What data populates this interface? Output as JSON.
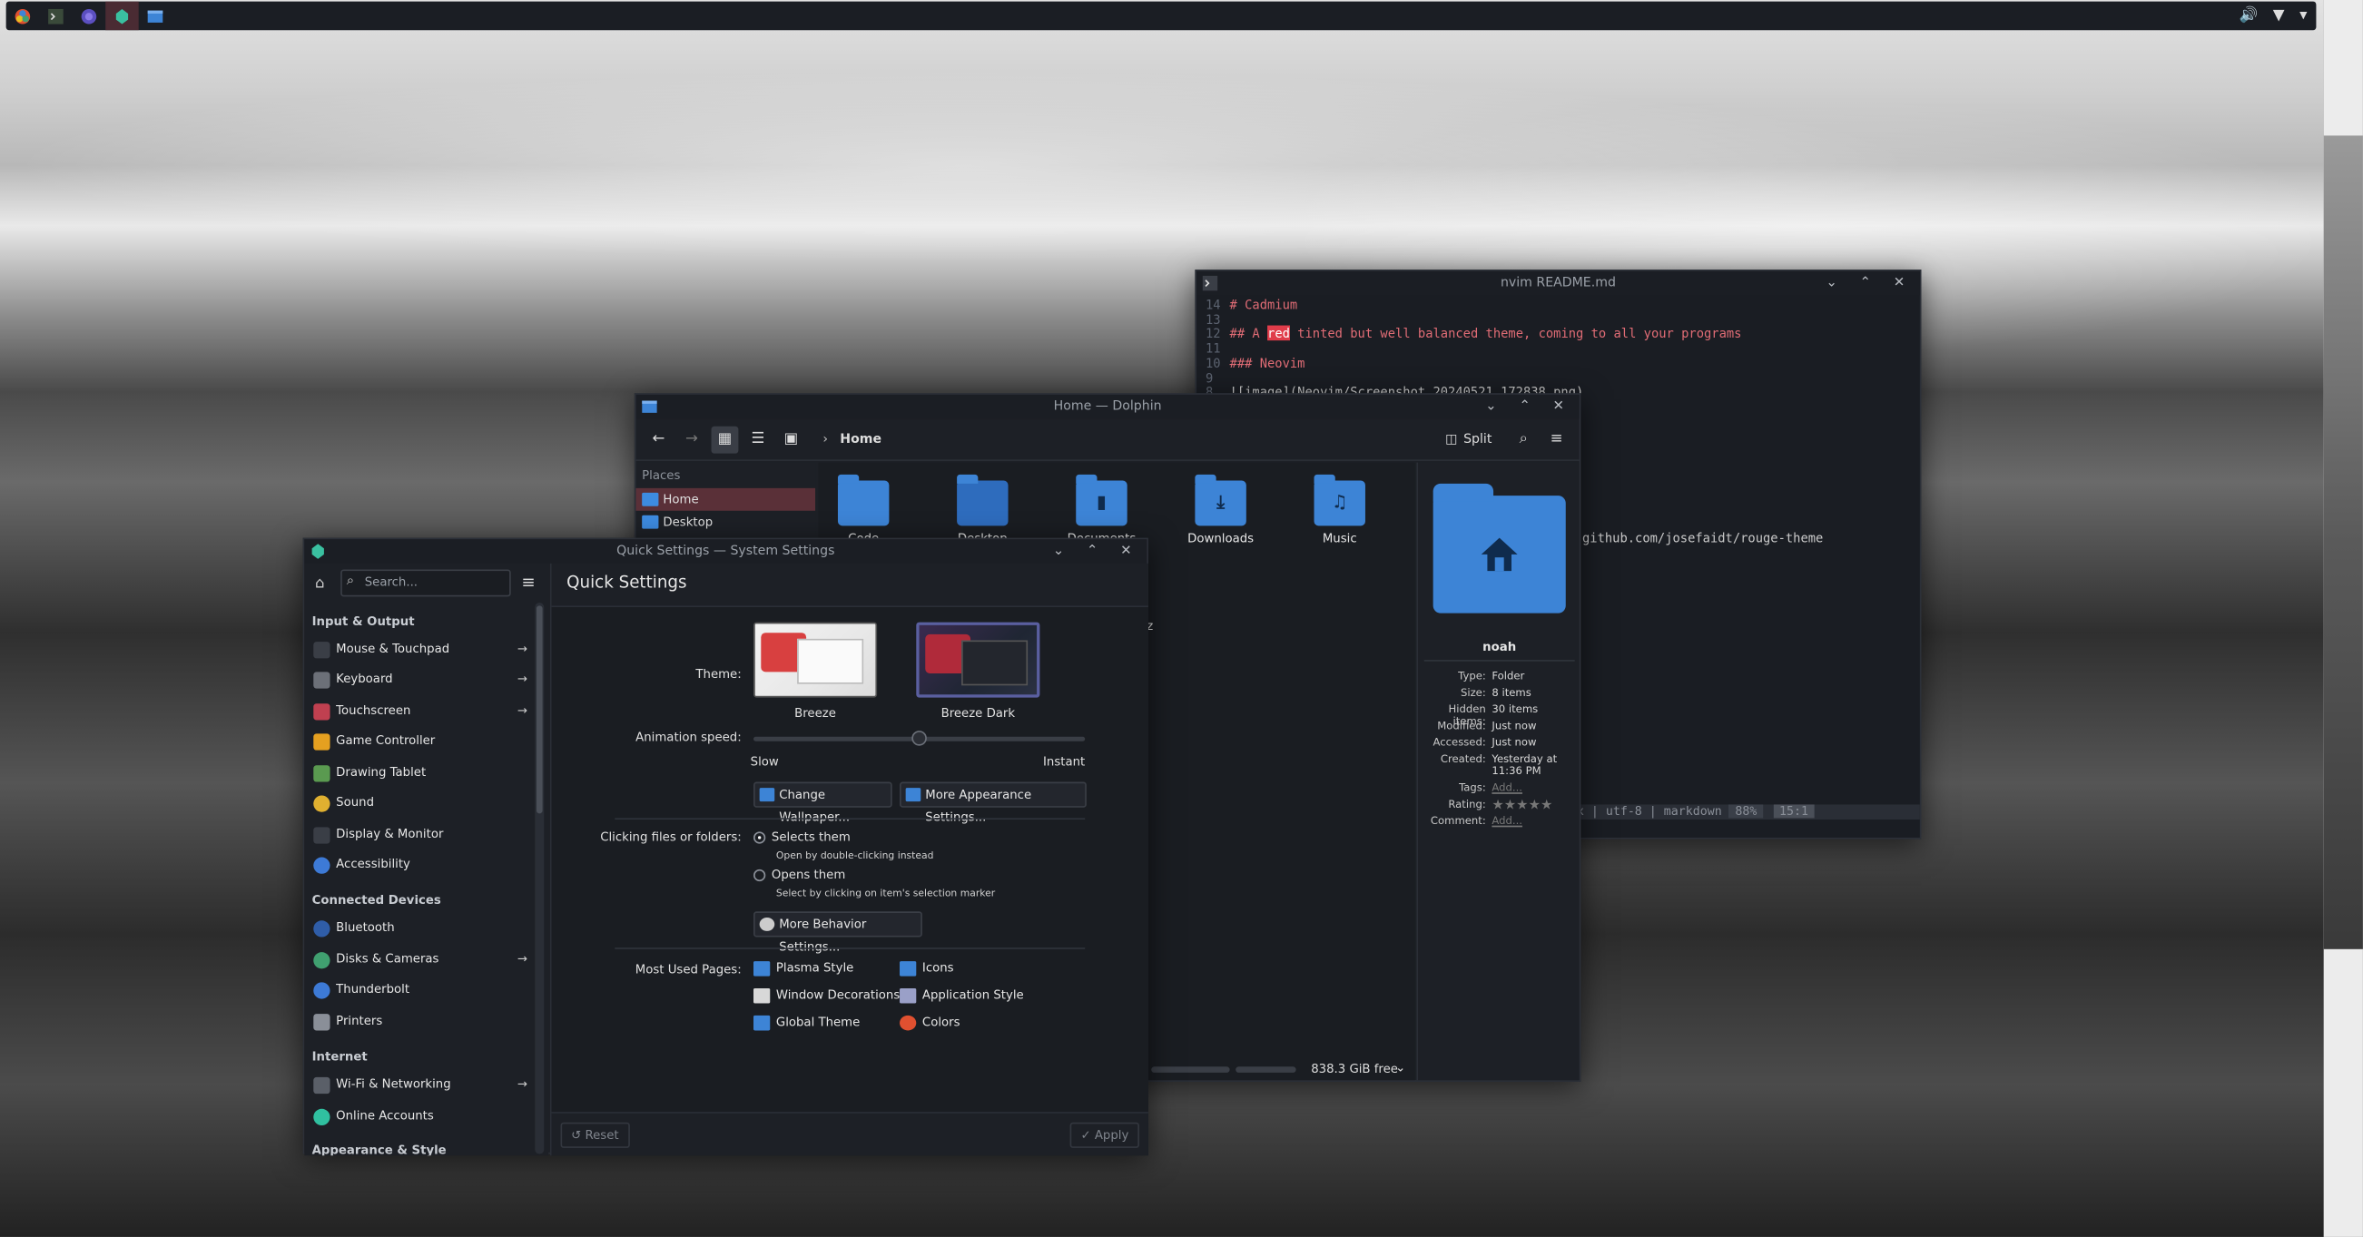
{
  "taskbar": {
    "tray_volume": "🔊",
    "tray_network": "▼",
    "tray_menu": "▾"
  },
  "nvim": {
    "title": "nvim README.md",
    "lines": [
      {
        "n": "14",
        "t": "# Cadmium"
      },
      {
        "n": "13",
        "t": ""
      },
      {
        "n": "12",
        "t_pre": "## A ",
        "t_hl": "red",
        "t_post": " tinted but well balanced theme, coming to all your programs"
      },
      {
        "n": "11",
        "t": ""
      },
      {
        "n": "10",
        "t": "### Neovim"
      },
      {
        "n": "9",
        "t": ""
      },
      {
        "n": "8",
        "t": "![image](Neovim/Screenshot_20240521_172838.png)"
      }
    ],
    "url_fragment": "github.com/josefaidt/rouge-theme",
    "status": "unix | utf-8 | markdown",
    "status_pct": "88%",
    "status_pos": "15:1"
  },
  "dolphin": {
    "title": "Home — Dolphin",
    "breadcrumb": "Home",
    "split_label": "Split",
    "places_header": "Places",
    "places": [
      {
        "label": "Home"
      },
      {
        "label": "Desktop"
      }
    ],
    "files": [
      {
        "label": "Code",
        "glyph": ""
      },
      {
        "label": "Desktop",
        "glyph": ""
      },
      {
        "label": "Documents",
        "glyph": "▮"
      },
      {
        "label": "Downloads",
        "glyph": "⤓"
      },
      {
        "label": "Music",
        "glyph": "♫"
      }
    ],
    "partial_z": "z",
    "info": {
      "name": "noah",
      "rows": [
        {
          "k": "Type:",
          "v": "Folder"
        },
        {
          "k": "Size:",
          "v": "8 items"
        },
        {
          "k": "Hidden items:",
          "v": "30 items"
        },
        {
          "k": "Modified:",
          "v": "Just now"
        },
        {
          "k": "Accessed:",
          "v": "Just now"
        },
        {
          "k": "Created:",
          "v": "Yesterday at 11:36 PM"
        },
        {
          "k": "Tags:",
          "v": "Add..."
        },
        {
          "k": "Rating:",
          "v": "★★★★★"
        },
        {
          "k": "Comment:",
          "v": "Add..."
        }
      ]
    },
    "free_space": "838.3 GiB free"
  },
  "settings": {
    "title": "Quick Settings — System Settings",
    "search_placeholder": "Search...",
    "page_title": "Quick Settings",
    "sidebar": {
      "sections": [
        {
          "label": "Input & Output",
          "items": [
            {
              "label": "Mouse & Touchpad",
              "arrow": "→",
              "color": "#3a3e46"
            },
            {
              "label": "Keyboard",
              "arrow": "→",
              "color": "#6c7078"
            },
            {
              "label": "Touchscreen",
              "arrow": "→",
              "color": "#c04050"
            },
            {
              "label": "Game Controller",
              "arrow": "",
              "color": "#e5a020"
            },
            {
              "label": "Drawing Tablet",
              "arrow": "",
              "color": "#5a9a50"
            },
            {
              "label": "Sound",
              "arrow": "",
              "color": "#e0b030"
            },
            {
              "label": "Display & Monitor",
              "arrow": "",
              "color": "#3a3e46"
            },
            {
              "label": "Accessibility",
              "arrow": "",
              "color": "#3d7ad6"
            }
          ]
        },
        {
          "label": "Connected Devices",
          "items": [
            {
              "label": "Bluetooth",
              "arrow": "",
              "color": "#2f5da8"
            },
            {
              "label": "Disks & Cameras",
              "arrow": "→",
              "color": "#40a070"
            },
            {
              "label": "Thunderbolt",
              "arrow": "",
              "color": "#3d7ad6"
            },
            {
              "label": "Printers",
              "arrow": "",
              "color": "#8a8f98"
            }
          ]
        },
        {
          "label": "Internet",
          "items": [
            {
              "label": "Wi-Fi & Networking",
              "arrow": "→",
              "color": "#5a5f68"
            },
            {
              "label": "Online Accounts",
              "arrow": "",
              "color": "#30c0a0"
            }
          ]
        },
        {
          "label": "Appearance & Style",
          "items": []
        }
      ]
    },
    "theme_label": "Theme:",
    "themes": [
      {
        "label": "Breeze"
      },
      {
        "label": "Breeze Dark"
      }
    ],
    "anim_label": "Animation speed:",
    "anim_slow": "Slow",
    "anim_instant": "Instant",
    "anim_value": 0.5,
    "change_wallpaper": "Change Wallpaper...",
    "more_appearance": "More Appearance Settings...",
    "click_label": "Clicking files or folders:",
    "opt1": "Selects them",
    "opt1_sub": "Open by double-clicking instead",
    "opt2": "Opens them",
    "opt2_sub": "Select by clicking on item's selection marker",
    "more_behavior": "More Behavior Settings...",
    "most_used_label": "Most Used Pages:",
    "most_used": [
      {
        "label": "Plasma Style",
        "color": "#3d84d6"
      },
      {
        "label": "Icons",
        "color": "#3d84d6"
      },
      {
        "label": "Window Decorations",
        "color": "#d8d8d8"
      },
      {
        "label": "Application Style",
        "color": "#9aa0c8"
      },
      {
        "label": "Global Theme",
        "color": "#3d84d6"
      },
      {
        "label": "Colors",
        "color": "#e05030"
      }
    ],
    "reset": "Reset",
    "apply": "Apply"
  }
}
